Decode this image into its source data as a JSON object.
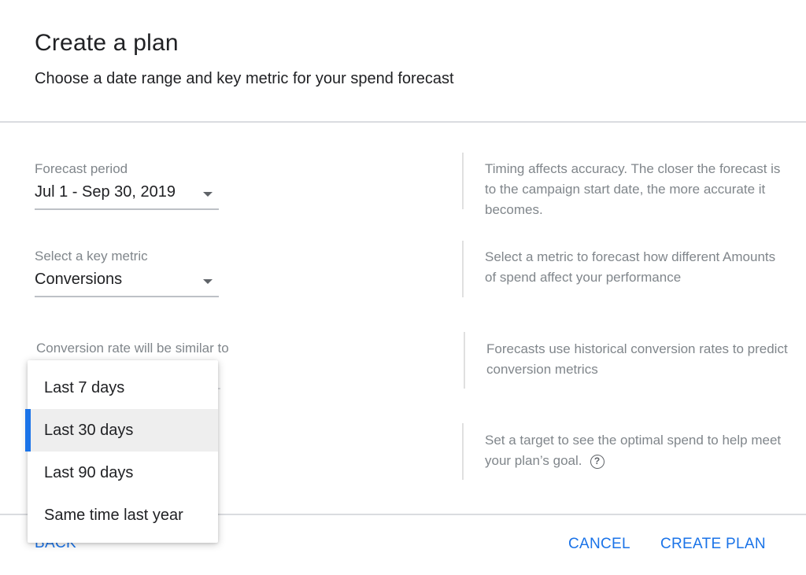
{
  "dialog": {
    "title": "Create a plan",
    "subtitle": "Choose a date range and key metric for your spend forecast"
  },
  "forecast_period": {
    "label": "Forecast period",
    "value": "Jul 1 - Sep 30, 2019",
    "help": "Timing affects accuracy. The closer the forecast is to the campaign start date, the more accurate it becomes."
  },
  "key_metric": {
    "label": "Select a key metric",
    "value": "Conversions",
    "help": "Select a metric to forecast how different Amounts of spend affect your performance"
  },
  "conversion_rate": {
    "label": "Conversion rate will be similar to",
    "help": "Forecasts use historical conversion rates to predict conversion metrics"
  },
  "target": {
    "help": "Set a target to see the optimal spend to help meet your plan’s goal.",
    "help_icon": "help-circle-icon"
  },
  "dropdown": {
    "options": [
      "Last 7 days",
      "Last 30 days",
      "Last 90 days",
      "Same time last year"
    ],
    "selected": "Last 30 days"
  },
  "footer": {
    "back_label": "BACK",
    "cancel_label": "CANCEL",
    "create_label": "CREATE PLAN"
  },
  "colors": {
    "accent": "#1a73e8",
    "muted_text": "#80868b"
  }
}
